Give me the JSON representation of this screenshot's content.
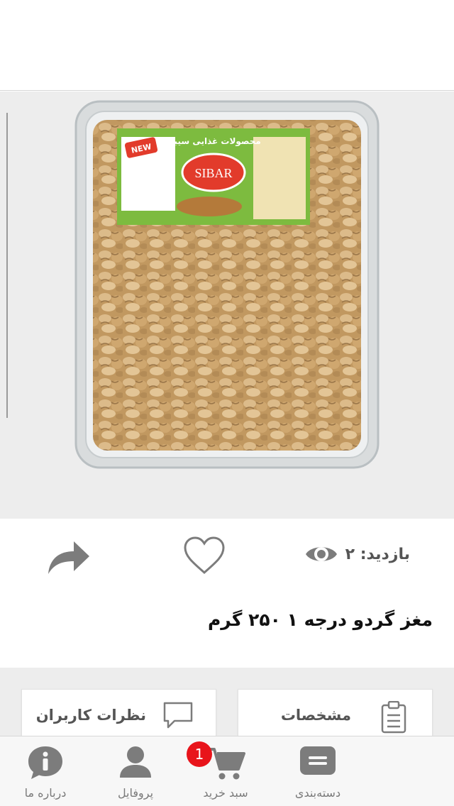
{
  "product": {
    "views_label": "بازدید: ۲",
    "title": "مغز گردو درجه ۱ ۲۵۰ گرم",
    "package_label": {
      "brand": "SIBAR",
      "header": "محصولات غذایی سیبار",
      "tag": "NEW"
    }
  },
  "tabs": {
    "specs": "مشخصات",
    "reviews": "نظرات کاربران"
  },
  "bottom_nav": {
    "categories": "دسته‌بندی",
    "cart": "سبد خرید",
    "cart_count": "1",
    "profile": "پروفایل",
    "about": "درباره ما"
  },
  "colors": {
    "icon_gray": "#7c7c7c",
    "badge_red": "#e8141b",
    "background": "#ededed"
  }
}
